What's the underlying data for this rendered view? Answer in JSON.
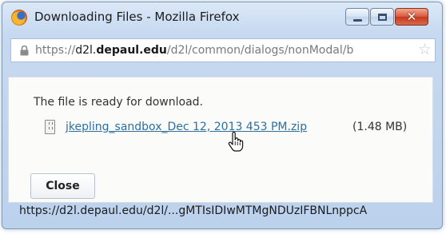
{
  "window": {
    "title": "Downloading Files - Mozilla Firefox",
    "controls": {
      "minimize_icon": "minimize-icon",
      "maximize_icon": "maximize-icon",
      "close_glyph": "✕"
    }
  },
  "urlbar": {
    "scheme": "https://",
    "host_prefix": "d2l.",
    "host_domain": "depaul.edu",
    "path": "/d2l/common/dialogs/nonModal/b",
    "lock_icon": "lock-icon",
    "star_icon": "bookmark-star-icon"
  },
  "dialog": {
    "message": "The file is ready for download.",
    "file_name": "jkepling_sandbox_Dec 12, 2013 453 PM.zip",
    "file_size": "(1.48 MB)",
    "close_label": "Close"
  },
  "status_bar": {
    "text": "https://d2l.depaul.edu/d2l/...gMTIsIDIwMTMgNDUzIFBNLnppcA"
  },
  "colors": {
    "link": "#2b6fa3",
    "close_button_red": "#c33a1e",
    "chrome_blue": "#c6d9f0"
  }
}
